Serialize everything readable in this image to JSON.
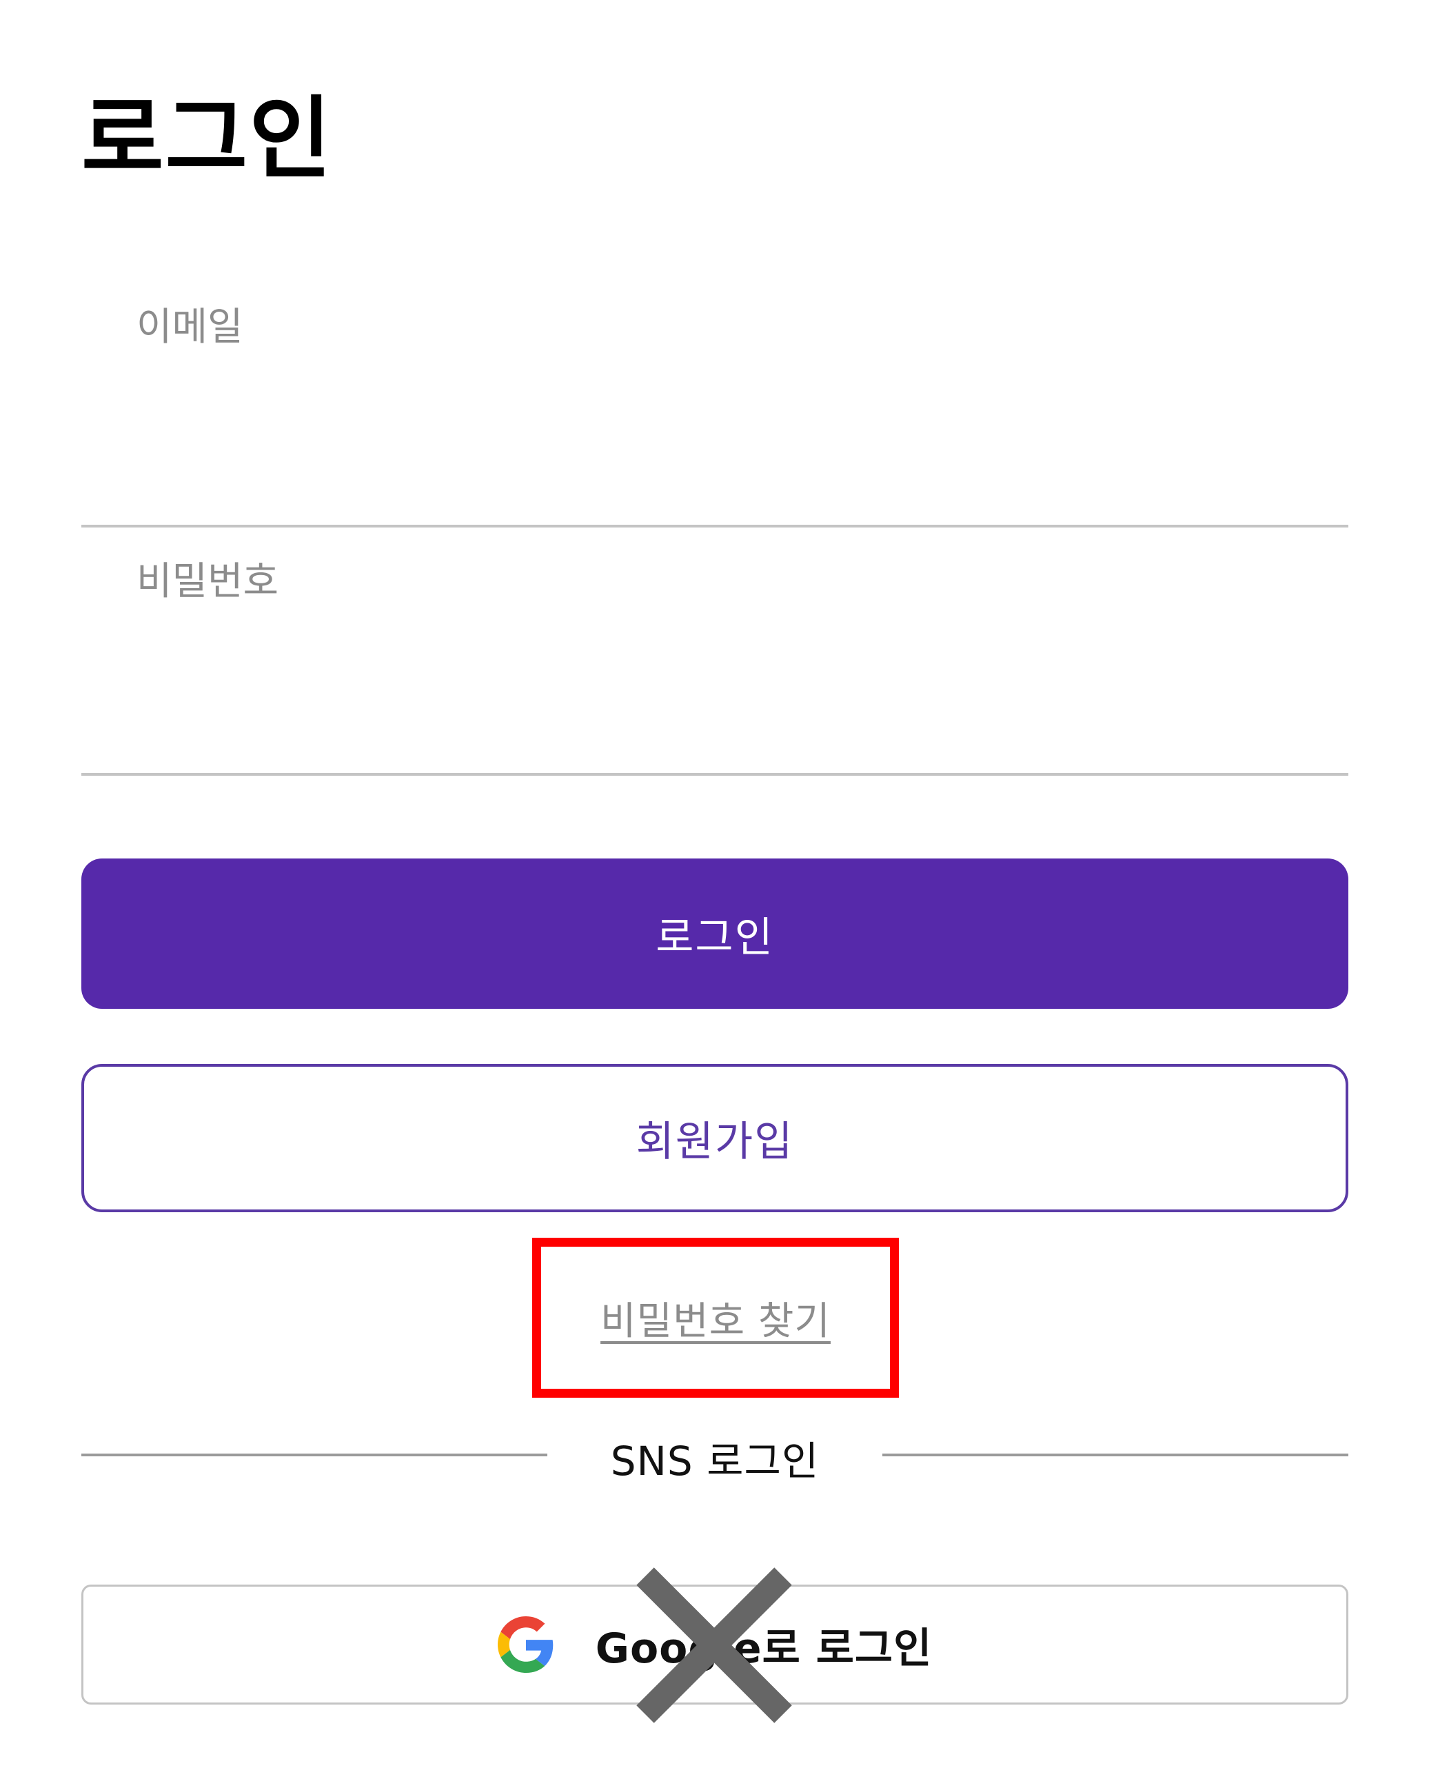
{
  "page": {
    "title": "로그인"
  },
  "form": {
    "email_placeholder": "이메일",
    "password_placeholder": "비밀번호",
    "login_label": "로그인",
    "signup_label": "회원가입",
    "find_password_label": "비밀번호 찾기"
  },
  "sns": {
    "divider_label": "SNS 로그인",
    "google_label": "Google로 로그인",
    "google_icon": "google-g-icon"
  },
  "annotations": {
    "highlight_color": "#ff0000",
    "cross_icon": "cross-mark-icon",
    "cross_color": "#666666"
  },
  "colors": {
    "accent": "#5629aa",
    "signup_border": "#5a3aa6",
    "placeholder": "#8c8c8c",
    "field_underline": "#c4c4c4"
  }
}
